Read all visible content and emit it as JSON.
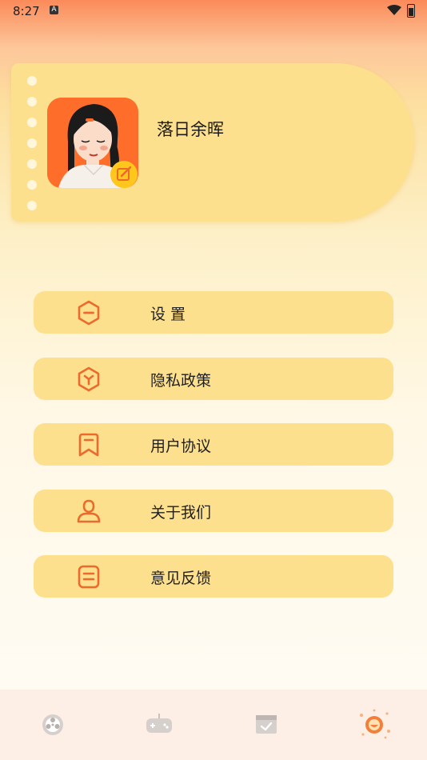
{
  "status_bar": {
    "time": "8:27",
    "notification_icon": "A"
  },
  "profile": {
    "username": "落日余晖",
    "avatar_icon": "avatar-illustration",
    "edit_icon": "edit-icon"
  },
  "menu": {
    "items": [
      {
        "label": "设 置",
        "icon": "settings-hexagon-icon"
      },
      {
        "label": "隐私政策",
        "icon": "privacy-icon"
      },
      {
        "label": "用户协议",
        "icon": "bookmark-icon"
      },
      {
        "label": "关于我们",
        "icon": "user-icon"
      },
      {
        "label": "意见反馈",
        "icon": "feedback-icon"
      }
    ]
  },
  "tabs": [
    {
      "name": "film-reel-icon"
    },
    {
      "name": "gamepad-icon"
    },
    {
      "name": "calendar-check-icon"
    },
    {
      "name": "profile-sun-icon",
      "active": true
    }
  ],
  "colors": {
    "accent": "#ec6a2c",
    "card": "#fde08d",
    "tabbar": "#fdeee6"
  }
}
